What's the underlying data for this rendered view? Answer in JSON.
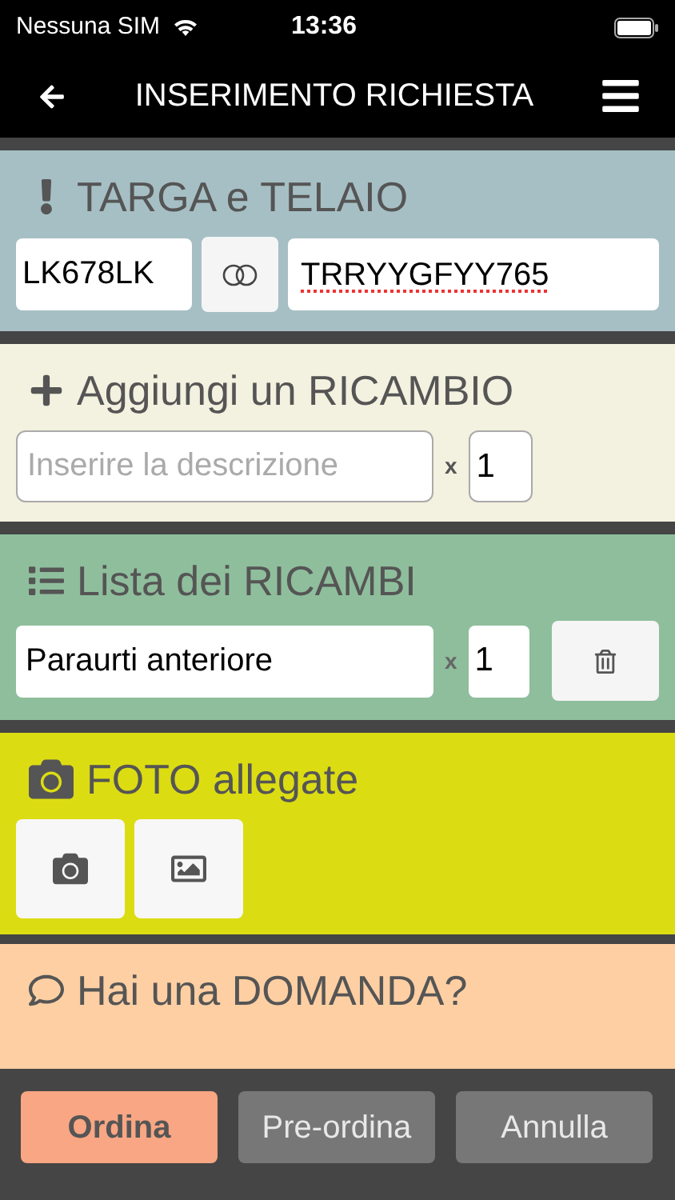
{
  "status_bar": {
    "carrier": "Nessuna SIM",
    "time": "13:36"
  },
  "nav": {
    "title": "INSERIMENTO RICHIESTA"
  },
  "plate_section": {
    "title": "TARGA e TELAIO",
    "plate": {
      "value": "LK678LK"
    },
    "frame": {
      "value": "TRRYYGFYY765",
      "spellcheck_error": true
    }
  },
  "add_section": {
    "title": "Aggiungi un RICAMBIO",
    "description": {
      "placeholder": "Inserire la descrizione"
    },
    "times": "x",
    "quantity": {
      "value": "1"
    }
  },
  "list_section": {
    "title": "Lista dei RICAMBI",
    "items": [
      {
        "description": "Paraurti anteriore",
        "times": "x",
        "quantity": "1"
      }
    ]
  },
  "photo_section": {
    "title": "FOTO allegate"
  },
  "question_section": {
    "title": "Hai una DOMANDA?"
  },
  "buttons": [
    {
      "label": "Ordina",
      "kind": "primary"
    },
    {
      "label": "Pre-ordina",
      "kind": "secondary"
    },
    {
      "label": "Annulla",
      "kind": "secondary"
    }
  ]
}
